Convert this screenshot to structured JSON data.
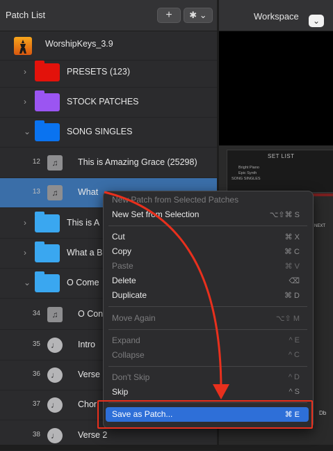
{
  "left_panel": {
    "title": "Patch List",
    "add_label": "+",
    "gear_label": "✱ ⌄",
    "library": {
      "name": "WorshipKeys_3.9"
    },
    "folders": [
      {
        "label": "PRESETS (123)",
        "color": "#e3120b",
        "expanded": false
      },
      {
        "label": "STOCK PATCHES",
        "color": "#9b55f2",
        "expanded": false
      },
      {
        "label": "SONG SINGLES",
        "color": "#0a73f0",
        "expanded": true
      }
    ],
    "patches": [
      {
        "num": "12",
        "label": "This is Amazing Grace (25298)"
      },
      {
        "num": "13",
        "label": "What"
      }
    ],
    "folders2": [
      {
        "label": "This is A",
        "color": "#3aa7f0"
      },
      {
        "label": "What a B",
        "color": "#3aa7f0"
      },
      {
        "label": "O Come",
        "color": "#3aa7f0"
      }
    ],
    "sub_items": [
      {
        "num": "34",
        "label": "O Con",
        "kind": "patch"
      },
      {
        "num": "35",
        "label": "Intro",
        "kind": "song"
      },
      {
        "num": "36",
        "label": "Verse",
        "kind": "song"
      },
      {
        "num": "37",
        "label": "Chor",
        "kind": "song"
      },
      {
        "num": "38",
        "label": "Verse 2",
        "kind": "song"
      }
    ]
  },
  "workspace": {
    "title": "Workspace",
    "dropdown": "⌄",
    "setlist_title": "SET LIST",
    "setlist_lines": [
      "Bright Piano",
      "Epic Synth",
      "SONG SINGLES"
    ],
    "next_label": "NEXT",
    "db_label": "Db"
  },
  "menu": {
    "items": [
      {
        "label": "New Patch from Selected Patches",
        "shortcut": "",
        "disabled": true
      },
      {
        "label": "New Set from Selection",
        "shortcut": "⌥⇧⌘ S",
        "disabled": false
      },
      {
        "label": "Cut",
        "shortcut": "⌘ X",
        "disabled": false
      },
      {
        "label": "Copy",
        "shortcut": "⌘ C",
        "disabled": false
      },
      {
        "label": "Paste",
        "shortcut": "⌘ V",
        "disabled": true
      },
      {
        "label": "Delete",
        "shortcut": "⌫",
        "disabled": false
      },
      {
        "label": "Duplicate",
        "shortcut": "⌘ D",
        "disabled": false
      },
      {
        "label": "Move Again",
        "shortcut": "⌥⇧ M",
        "disabled": true
      },
      {
        "label": "Expand",
        "shortcut": "^ E",
        "disabled": true
      },
      {
        "label": "Collapse",
        "shortcut": "^ C",
        "disabled": true
      },
      {
        "label": "Don't Skip",
        "shortcut": "^ D",
        "disabled": true
      },
      {
        "label": "Skip",
        "shortcut": "^ S",
        "disabled": false
      },
      {
        "label": "Save as Patch...",
        "shortcut": "⌘ E",
        "disabled": false,
        "highlighted": true
      }
    ]
  },
  "colors": {
    "selection": "#3a6ea8",
    "menu_highlight": "#2e6fd8",
    "annotation_red": "#e8301d"
  }
}
